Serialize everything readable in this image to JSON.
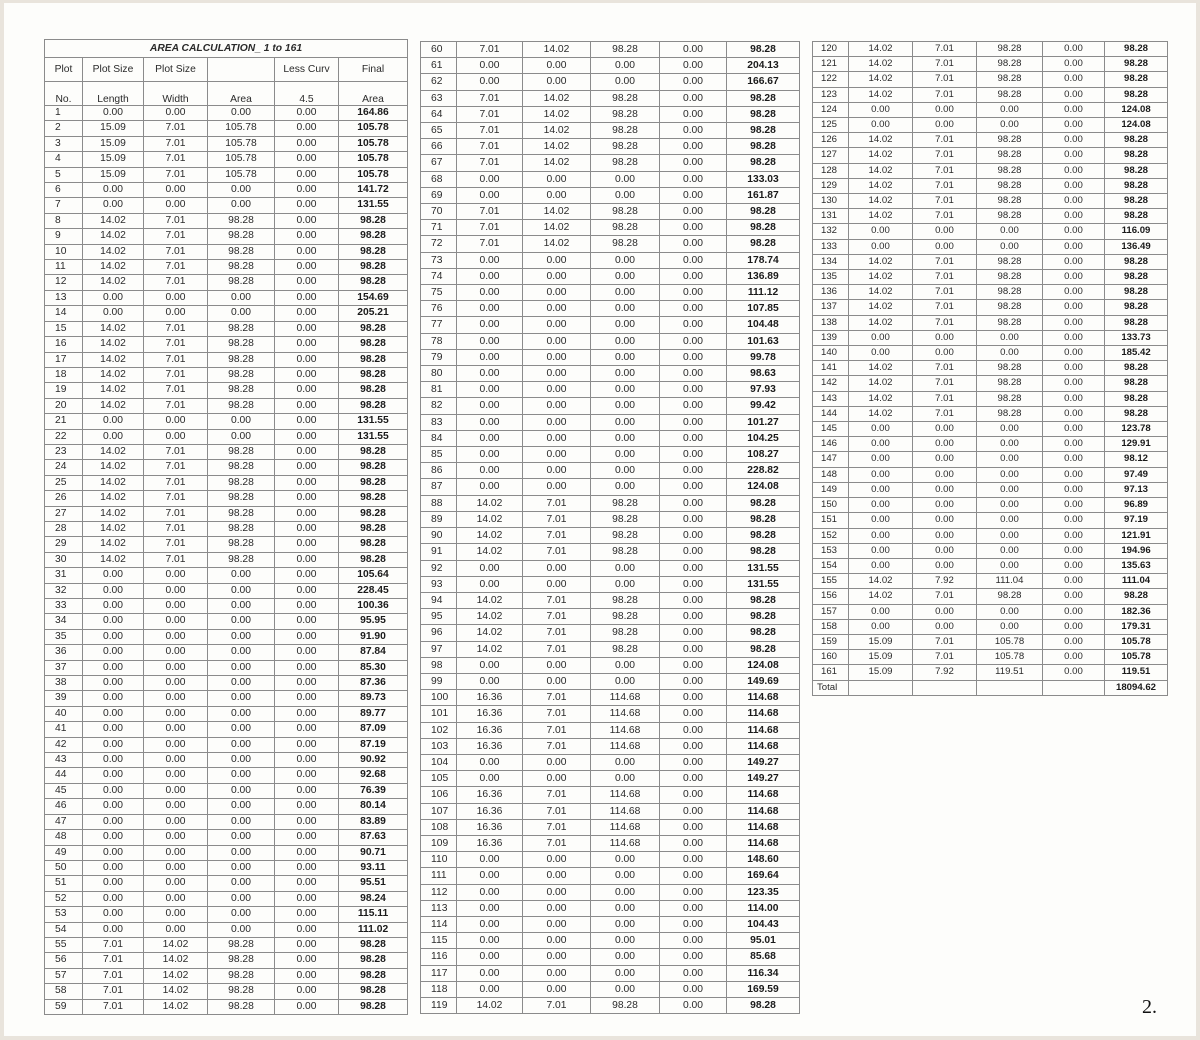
{
  "title": "AREA CALCULATION_ 1 to 161",
  "headers": {
    "row1": [
      "Plot",
      "Plot Size",
      "Plot Size",
      "",
      "Less Curv",
      "Final"
    ],
    "row2": [
      "No.",
      "Length",
      "Width",
      "Area",
      "4.5",
      "Area"
    ]
  },
  "rows": [
    [
      "1",
      "0.00",
      "0.00",
      "0.00",
      "0.00",
      "164.86"
    ],
    [
      "2",
      "15.09",
      "7.01",
      "105.78",
      "0.00",
      "105.78"
    ],
    [
      "3",
      "15.09",
      "7.01",
      "105.78",
      "0.00",
      "105.78"
    ],
    [
      "4",
      "15.09",
      "7.01",
      "105.78",
      "0.00",
      "105.78"
    ],
    [
      "5",
      "15.09",
      "7.01",
      "105.78",
      "0.00",
      "105.78"
    ],
    [
      "6",
      "0.00",
      "0.00",
      "0.00",
      "0.00",
      "141.72"
    ],
    [
      "7",
      "0.00",
      "0.00",
      "0.00",
      "0.00",
      "131.55"
    ],
    [
      "8",
      "14.02",
      "7.01",
      "98.28",
      "0.00",
      "98.28"
    ],
    [
      "9",
      "14.02",
      "7.01",
      "98.28",
      "0.00",
      "98.28"
    ],
    [
      "10",
      "14.02",
      "7.01",
      "98.28",
      "0.00",
      "98.28"
    ],
    [
      "11",
      "14.02",
      "7.01",
      "98.28",
      "0.00",
      "98.28"
    ],
    [
      "12",
      "14.02",
      "7.01",
      "98.28",
      "0.00",
      "98.28"
    ],
    [
      "13",
      "0.00",
      "0.00",
      "0.00",
      "0.00",
      "154.69"
    ],
    [
      "14",
      "0.00",
      "0.00",
      "0.00",
      "0.00",
      "205.21"
    ],
    [
      "15",
      "14.02",
      "7.01",
      "98.28",
      "0.00",
      "98.28"
    ],
    [
      "16",
      "14.02",
      "7.01",
      "98.28",
      "0.00",
      "98.28"
    ],
    [
      "17",
      "14.02",
      "7.01",
      "98.28",
      "0.00",
      "98.28"
    ],
    [
      "18",
      "14.02",
      "7.01",
      "98.28",
      "0.00",
      "98.28"
    ],
    [
      "19",
      "14.02",
      "7.01",
      "98.28",
      "0.00",
      "98.28"
    ],
    [
      "20",
      "14.02",
      "7.01",
      "98.28",
      "0.00",
      "98.28"
    ],
    [
      "21",
      "0.00",
      "0.00",
      "0.00",
      "0.00",
      "131.55"
    ],
    [
      "22",
      "0.00",
      "0.00",
      "0.00",
      "0.00",
      "131.55"
    ],
    [
      "23",
      "14.02",
      "7.01",
      "98.28",
      "0.00",
      "98.28"
    ],
    [
      "24",
      "14.02",
      "7.01",
      "98.28",
      "0.00",
      "98.28"
    ],
    [
      "25",
      "14.02",
      "7.01",
      "98.28",
      "0.00",
      "98.28"
    ],
    [
      "26",
      "14.02",
      "7.01",
      "98.28",
      "0.00",
      "98.28"
    ],
    [
      "27",
      "14.02",
      "7.01",
      "98.28",
      "0.00",
      "98.28"
    ],
    [
      "28",
      "14.02",
      "7.01",
      "98.28",
      "0.00",
      "98.28"
    ],
    [
      "29",
      "14.02",
      "7.01",
      "98.28",
      "0.00",
      "98.28"
    ],
    [
      "30",
      "14.02",
      "7.01",
      "98.28",
      "0.00",
      "98.28"
    ],
    [
      "31",
      "0.00",
      "0.00",
      "0.00",
      "0.00",
      "105.64"
    ],
    [
      "32",
      "0.00",
      "0.00",
      "0.00",
      "0.00",
      "228.45"
    ],
    [
      "33",
      "0.00",
      "0.00",
      "0.00",
      "0.00",
      "100.36"
    ],
    [
      "34",
      "0.00",
      "0.00",
      "0.00",
      "0.00",
      "95.95"
    ],
    [
      "35",
      "0.00",
      "0.00",
      "0.00",
      "0.00",
      "91.90"
    ],
    [
      "36",
      "0.00",
      "0.00",
      "0.00",
      "0.00",
      "87.84"
    ],
    [
      "37",
      "0.00",
      "0.00",
      "0.00",
      "0.00",
      "85.30"
    ],
    [
      "38",
      "0.00",
      "0.00",
      "0.00",
      "0.00",
      "87.36"
    ],
    [
      "39",
      "0.00",
      "0.00",
      "0.00",
      "0.00",
      "89.73"
    ],
    [
      "40",
      "0.00",
      "0.00",
      "0.00",
      "0.00",
      "89.77"
    ],
    [
      "41",
      "0.00",
      "0.00",
      "0.00",
      "0.00",
      "87.09"
    ],
    [
      "42",
      "0.00",
      "0.00",
      "0.00",
      "0.00",
      "87.19"
    ],
    [
      "43",
      "0.00",
      "0.00",
      "0.00",
      "0.00",
      "90.92"
    ],
    [
      "44",
      "0.00",
      "0.00",
      "0.00",
      "0.00",
      "92.68"
    ],
    [
      "45",
      "0.00",
      "0.00",
      "0.00",
      "0.00",
      "76.39"
    ],
    [
      "46",
      "0.00",
      "0.00",
      "0.00",
      "0.00",
      "80.14"
    ],
    [
      "47",
      "0.00",
      "0.00",
      "0.00",
      "0.00",
      "83.89"
    ],
    [
      "48",
      "0.00",
      "0.00",
      "0.00",
      "0.00",
      "87.63"
    ],
    [
      "49",
      "0.00",
      "0.00",
      "0.00",
      "0.00",
      "90.71"
    ],
    [
      "50",
      "0.00",
      "0.00",
      "0.00",
      "0.00",
      "93.11"
    ],
    [
      "51",
      "0.00",
      "0.00",
      "0.00",
      "0.00",
      "95.51"
    ],
    [
      "52",
      "0.00",
      "0.00",
      "0.00",
      "0.00",
      "98.24"
    ],
    [
      "53",
      "0.00",
      "0.00",
      "0.00",
      "0.00",
      "115.11"
    ],
    [
      "54",
      "0.00",
      "0.00",
      "0.00",
      "0.00",
      "111.02"
    ],
    [
      "55",
      "7.01",
      "14.02",
      "98.28",
      "0.00",
      "98.28"
    ],
    [
      "56",
      "7.01",
      "14.02",
      "98.28",
      "0.00",
      "98.28"
    ],
    [
      "57",
      "7.01",
      "14.02",
      "98.28",
      "0.00",
      "98.28"
    ],
    [
      "58",
      "7.01",
      "14.02",
      "98.28",
      "0.00",
      "98.28"
    ],
    [
      "59",
      "7.01",
      "14.02",
      "98.28",
      "0.00",
      "98.28"
    ],
    [
      "60",
      "7.01",
      "14.02",
      "98.28",
      "0.00",
      "98.28"
    ],
    [
      "61",
      "0.00",
      "0.00",
      "0.00",
      "0.00",
      "204.13"
    ],
    [
      "62",
      "0.00",
      "0.00",
      "0.00",
      "0.00",
      "166.67"
    ],
    [
      "63",
      "7.01",
      "14.02",
      "98.28",
      "0.00",
      "98.28"
    ],
    [
      "64",
      "7.01",
      "14.02",
      "98.28",
      "0.00",
      "98.28"
    ],
    [
      "65",
      "7.01",
      "14.02",
      "98.28",
      "0.00",
      "98.28"
    ],
    [
      "66",
      "7.01",
      "14.02",
      "98.28",
      "0.00",
      "98.28"
    ],
    [
      "67",
      "7.01",
      "14.02",
      "98.28",
      "0.00",
      "98.28"
    ],
    [
      "68",
      "0.00",
      "0.00",
      "0.00",
      "0.00",
      "133.03"
    ],
    [
      "69",
      "0.00",
      "0.00",
      "0.00",
      "0.00",
      "161.87"
    ],
    [
      "70",
      "7.01",
      "14.02",
      "98.28",
      "0.00",
      "98.28"
    ],
    [
      "71",
      "7.01",
      "14.02",
      "98.28",
      "0.00",
      "98.28"
    ],
    [
      "72",
      "7.01",
      "14.02",
      "98.28",
      "0.00",
      "98.28"
    ],
    [
      "73",
      "0.00",
      "0.00",
      "0.00",
      "0.00",
      "178.74"
    ],
    [
      "74",
      "0.00",
      "0.00",
      "0.00",
      "0.00",
      "136.89"
    ],
    [
      "75",
      "0.00",
      "0.00",
      "0.00",
      "0.00",
      "111.12"
    ],
    [
      "76",
      "0.00",
      "0.00",
      "0.00",
      "0.00",
      "107.85"
    ],
    [
      "77",
      "0.00",
      "0.00",
      "0.00",
      "0.00",
      "104.48"
    ],
    [
      "78",
      "0.00",
      "0.00",
      "0.00",
      "0.00",
      "101.63"
    ],
    [
      "79",
      "0.00",
      "0.00",
      "0.00",
      "0.00",
      "99.78"
    ],
    [
      "80",
      "0.00",
      "0.00",
      "0.00",
      "0.00",
      "98.63"
    ],
    [
      "81",
      "0.00",
      "0.00",
      "0.00",
      "0.00",
      "97.93"
    ],
    [
      "82",
      "0.00",
      "0.00",
      "0.00",
      "0.00",
      "99.42"
    ],
    [
      "83",
      "0.00",
      "0.00",
      "0.00",
      "0.00",
      "101.27"
    ],
    [
      "84",
      "0.00",
      "0.00",
      "0.00",
      "0.00",
      "104.25"
    ],
    [
      "85",
      "0.00",
      "0.00",
      "0.00",
      "0.00",
      "108.27"
    ],
    [
      "86",
      "0.00",
      "0.00",
      "0.00",
      "0.00",
      "228.82"
    ],
    [
      "87",
      "0.00",
      "0.00",
      "0.00",
      "0.00",
      "124.08"
    ],
    [
      "88",
      "14.02",
      "7.01",
      "98.28",
      "0.00",
      "98.28"
    ],
    [
      "89",
      "14.02",
      "7.01",
      "98.28",
      "0.00",
      "98.28"
    ],
    [
      "90",
      "14.02",
      "7.01",
      "98.28",
      "0.00",
      "98.28"
    ],
    [
      "91",
      "14.02",
      "7.01",
      "98.28",
      "0.00",
      "98.28"
    ],
    [
      "92",
      "0.00",
      "0.00",
      "0.00",
      "0.00",
      "131.55"
    ],
    [
      "93",
      "0.00",
      "0.00",
      "0.00",
      "0.00",
      "131.55"
    ],
    [
      "94",
      "14.02",
      "7.01",
      "98.28",
      "0.00",
      "98.28"
    ],
    [
      "95",
      "14.02",
      "7.01",
      "98.28",
      "0.00",
      "98.28"
    ],
    [
      "96",
      "14.02",
      "7.01",
      "98.28",
      "0.00",
      "98.28"
    ],
    [
      "97",
      "14.02",
      "7.01",
      "98.28",
      "0.00",
      "98.28"
    ],
    [
      "98",
      "0.00",
      "0.00",
      "0.00",
      "0.00",
      "124.08"
    ],
    [
      "99",
      "0.00",
      "0.00",
      "0.00",
      "0.00",
      "149.69"
    ],
    [
      "100",
      "16.36",
      "7.01",
      "114.68",
      "0.00",
      "114.68"
    ],
    [
      "101",
      "16.36",
      "7.01",
      "114.68",
      "0.00",
      "114.68"
    ],
    [
      "102",
      "16.36",
      "7.01",
      "114.68",
      "0.00",
      "114.68"
    ],
    [
      "103",
      "16.36",
      "7.01",
      "114.68",
      "0.00",
      "114.68"
    ],
    [
      "104",
      "0.00",
      "0.00",
      "0.00",
      "0.00",
      "149.27"
    ],
    [
      "105",
      "0.00",
      "0.00",
      "0.00",
      "0.00",
      "149.27"
    ],
    [
      "106",
      "16.36",
      "7.01",
      "114.68",
      "0.00",
      "114.68"
    ],
    [
      "107",
      "16.36",
      "7.01",
      "114.68",
      "0.00",
      "114.68"
    ],
    [
      "108",
      "16.36",
      "7.01",
      "114.68",
      "0.00",
      "114.68"
    ],
    [
      "109",
      "16.36",
      "7.01",
      "114.68",
      "0.00",
      "114.68"
    ],
    [
      "110",
      "0.00",
      "0.00",
      "0.00",
      "0.00",
      "148.60"
    ],
    [
      "111",
      "0.00",
      "0.00",
      "0.00",
      "0.00",
      "169.64"
    ],
    [
      "112",
      "0.00",
      "0.00",
      "0.00",
      "0.00",
      "123.35"
    ],
    [
      "113",
      "0.00",
      "0.00",
      "0.00",
      "0.00",
      "114.00"
    ],
    [
      "114",
      "0.00",
      "0.00",
      "0.00",
      "0.00",
      "104.43"
    ],
    [
      "115",
      "0.00",
      "0.00",
      "0.00",
      "0.00",
      "95.01"
    ],
    [
      "116",
      "0.00",
      "0.00",
      "0.00",
      "0.00",
      "85.68"
    ],
    [
      "117",
      "0.00",
      "0.00",
      "0.00",
      "0.00",
      "116.34"
    ],
    [
      "118",
      "0.00",
      "0.00",
      "0.00",
      "0.00",
      "169.59"
    ],
    [
      "119",
      "14.02",
      "7.01",
      "98.28",
      "0.00",
      "98.28"
    ],
    [
      "120",
      "14.02",
      "7.01",
      "98.28",
      "0.00",
      "98.28"
    ],
    [
      "121",
      "14.02",
      "7.01",
      "98.28",
      "0.00",
      "98.28"
    ],
    [
      "122",
      "14.02",
      "7.01",
      "98.28",
      "0.00",
      "98.28"
    ],
    [
      "123",
      "14.02",
      "7.01",
      "98.28",
      "0.00",
      "98.28"
    ],
    [
      "124",
      "0.00",
      "0.00",
      "0.00",
      "0.00",
      "124.08"
    ],
    [
      "125",
      "0.00",
      "0.00",
      "0.00",
      "0.00",
      "124.08"
    ],
    [
      "126",
      "14.02",
      "7.01",
      "98.28",
      "0.00",
      "98.28"
    ],
    [
      "127",
      "14.02",
      "7.01",
      "98.28",
      "0.00",
      "98.28"
    ],
    [
      "128",
      "14.02",
      "7.01",
      "98.28",
      "0.00",
      "98.28"
    ],
    [
      "129",
      "14.02",
      "7.01",
      "98.28",
      "0.00",
      "98.28"
    ],
    [
      "130",
      "14.02",
      "7.01",
      "98.28",
      "0.00",
      "98.28"
    ],
    [
      "131",
      "14.02",
      "7.01",
      "98.28",
      "0.00",
      "98.28"
    ],
    [
      "132",
      "0.00",
      "0.00",
      "0.00",
      "0.00",
      "116.09"
    ],
    [
      "133",
      "0.00",
      "0.00",
      "0.00",
      "0.00",
      "136.49"
    ],
    [
      "134",
      "14.02",
      "7.01",
      "98.28",
      "0.00",
      "98.28"
    ],
    [
      "135",
      "14.02",
      "7.01",
      "98.28",
      "0.00",
      "98.28"
    ],
    [
      "136",
      "14.02",
      "7.01",
      "98.28",
      "0.00",
      "98.28"
    ],
    [
      "137",
      "14.02",
      "7.01",
      "98.28",
      "0.00",
      "98.28"
    ],
    [
      "138",
      "14.02",
      "7.01",
      "98.28",
      "0.00",
      "98.28"
    ],
    [
      "139",
      "0.00",
      "0.00",
      "0.00",
      "0.00",
      "133.73"
    ],
    [
      "140",
      "0.00",
      "0.00",
      "0.00",
      "0.00",
      "185.42"
    ],
    [
      "141",
      "14.02",
      "7.01",
      "98.28",
      "0.00",
      "98.28"
    ],
    [
      "142",
      "14.02",
      "7.01",
      "98.28",
      "0.00",
      "98.28"
    ],
    [
      "143",
      "14.02",
      "7.01",
      "98.28",
      "0.00",
      "98.28"
    ],
    [
      "144",
      "14.02",
      "7.01",
      "98.28",
      "0.00",
      "98.28"
    ],
    [
      "145",
      "0.00",
      "0.00",
      "0.00",
      "0.00",
      "123.78"
    ],
    [
      "146",
      "0.00",
      "0.00",
      "0.00",
      "0.00",
      "129.91"
    ],
    [
      "147",
      "0.00",
      "0.00",
      "0.00",
      "0.00",
      "98.12"
    ],
    [
      "148",
      "0.00",
      "0.00",
      "0.00",
      "0.00",
      "97.49"
    ],
    [
      "149",
      "0.00",
      "0.00",
      "0.00",
      "0.00",
      "97.13"
    ],
    [
      "150",
      "0.00",
      "0.00",
      "0.00",
      "0.00",
      "96.89"
    ],
    [
      "151",
      "0.00",
      "0.00",
      "0.00",
      "0.00",
      "97.19"
    ],
    [
      "152",
      "0.00",
      "0.00",
      "0.00",
      "0.00",
      "121.91"
    ],
    [
      "153",
      "0.00",
      "0.00",
      "0.00",
      "0.00",
      "194.96"
    ],
    [
      "154",
      "0.00",
      "0.00",
      "0.00",
      "0.00",
      "135.63"
    ],
    [
      "155",
      "14.02",
      "7.92",
      "111.04",
      "0.00",
      "111.04"
    ],
    [
      "156",
      "14.02",
      "7.01",
      "98.28",
      "0.00",
      "98.28"
    ],
    [
      "157",
      "0.00",
      "0.00",
      "0.00",
      "0.00",
      "182.36"
    ],
    [
      "158",
      "0.00",
      "0.00",
      "0.00",
      "0.00",
      "179.31"
    ],
    [
      "159",
      "15.09",
      "7.01",
      "105.78",
      "0.00",
      "105.78"
    ],
    [
      "160",
      "15.09",
      "7.01",
      "105.78",
      "0.00",
      "105.78"
    ],
    [
      "161",
      "15.09",
      "7.92",
      "119.51",
      "0.00",
      "119.51"
    ]
  ],
  "total": {
    "label": "Total",
    "value": "18094.62"
  },
  "page_number": "2."
}
